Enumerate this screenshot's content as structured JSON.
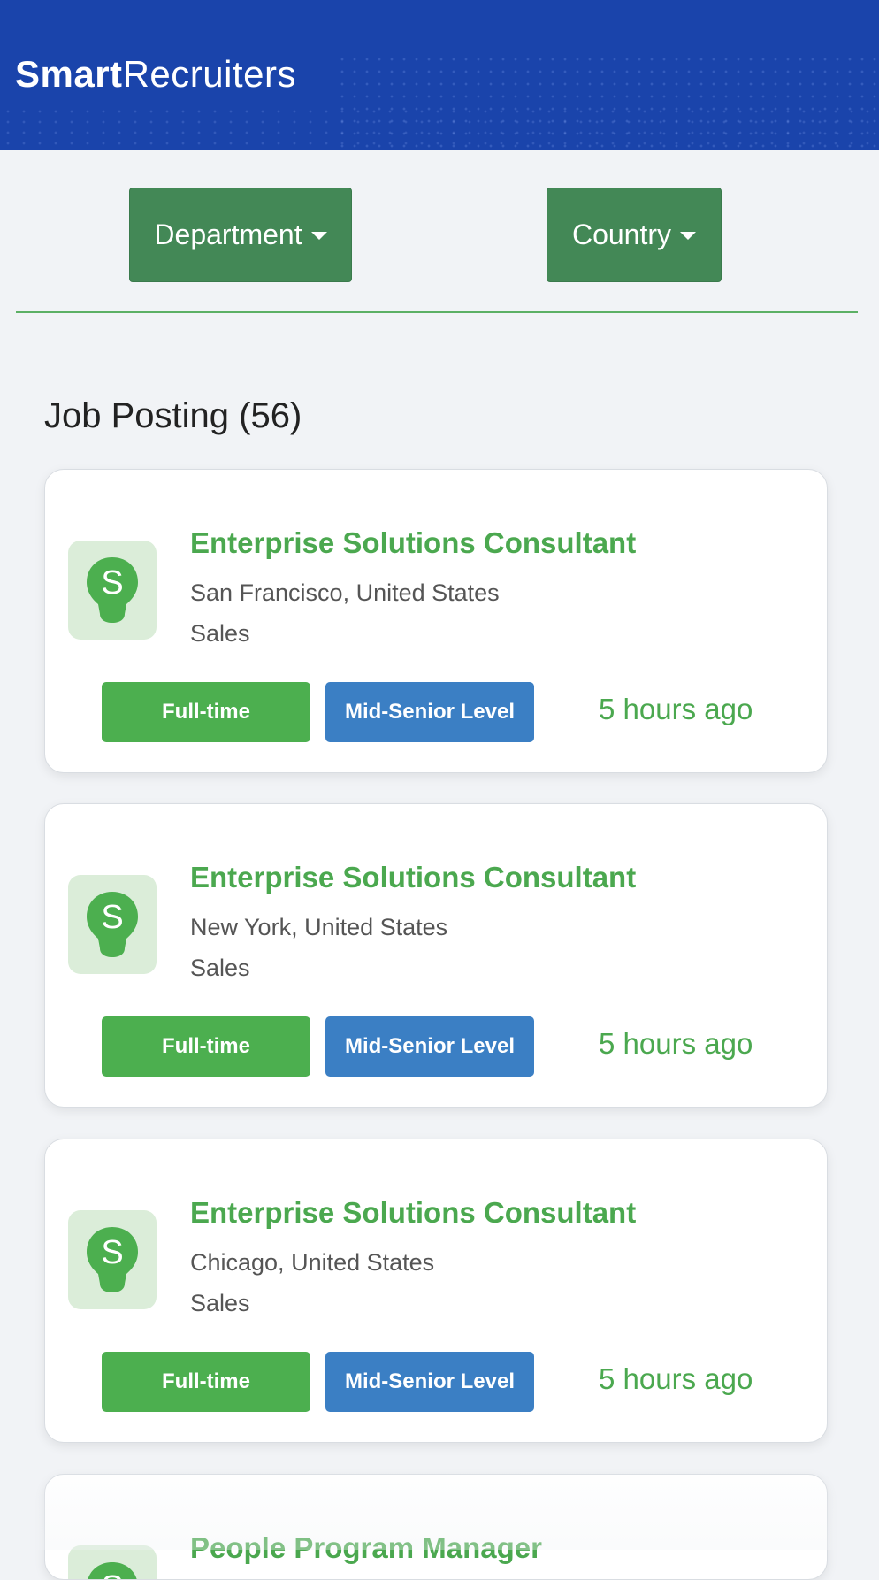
{
  "header": {
    "logo_bold": "Smart",
    "logo_light": "Recruiters"
  },
  "filters": {
    "department_label": "Department",
    "country_label": "Country"
  },
  "section": {
    "title": "Job Posting (56)"
  },
  "jobs": [
    {
      "title": "Enterprise Solutions Consultant",
      "location": "San Francisco, United States",
      "department": "Sales",
      "type": "Full-time",
      "level": "Mid-Senior Level",
      "posted": "5 hours ago",
      "logo_letter": "S"
    },
    {
      "title": "Enterprise Solutions Consultant",
      "location": "New York, United States",
      "department": "Sales",
      "type": "Full-time",
      "level": "Mid-Senior Level",
      "posted": "5 hours ago",
      "logo_letter": "S"
    },
    {
      "title": "Enterprise Solutions Consultant",
      "location": "Chicago, United States",
      "department": "Sales",
      "type": "Full-time",
      "level": "Mid-Senior Level",
      "posted": "5 hours ago",
      "logo_letter": "S"
    },
    {
      "title": "People Program Manager",
      "logo_letter": "S"
    }
  ],
  "colors": {
    "header_bg": "#1a44ab",
    "filter_button": "#438856",
    "accent_green": "#4ba84f",
    "badge_blue": "#3b7fc4",
    "page_bg": "#f1f3f6"
  },
  "icons": {
    "company_logo": "lightbulb-s-icon",
    "dropdown_caret": "caret-down-icon"
  }
}
